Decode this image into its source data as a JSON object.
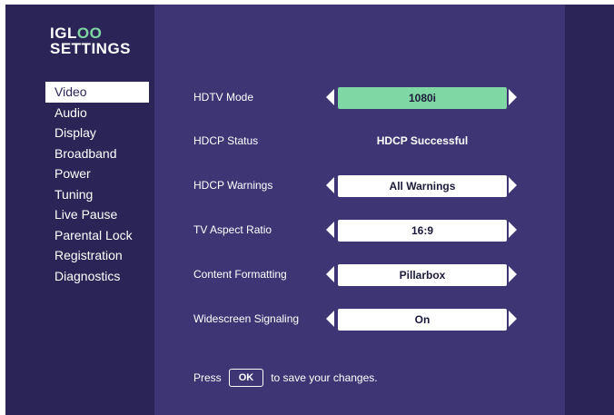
{
  "logo": {
    "line1_a": "IGL",
    "line1_b": "OO",
    "line2": "SETTINGS"
  },
  "nav": {
    "items": [
      {
        "label": "Video",
        "active": true
      },
      {
        "label": "Audio"
      },
      {
        "label": "Display"
      },
      {
        "label": "Broadband"
      },
      {
        "label": "Power"
      },
      {
        "label": "Tuning"
      },
      {
        "label": "Live Pause"
      },
      {
        "label": "Parental Lock"
      },
      {
        "label": "Registration"
      },
      {
        "label": "Diagnostics"
      }
    ]
  },
  "settings": [
    {
      "label": "HDTV Mode",
      "value": "1080i",
      "selectable": true,
      "selected": true
    },
    {
      "label": "HDCP Status",
      "value": "HDCP Successful",
      "selectable": false
    },
    {
      "label": "HDCP Warnings",
      "value": "All Warnings",
      "selectable": true
    },
    {
      "label": "TV Aspect Ratio",
      "value": "16:9",
      "selectable": true
    },
    {
      "label": "Content Formatting",
      "value": "Pillarbox",
      "selectable": true
    },
    {
      "label": "Widescreen Signaling",
      "value": "On",
      "selectable": true
    }
  ],
  "footer": {
    "press": "Press",
    "ok": "OK",
    "suffix": "to save your changes."
  },
  "colors": {
    "background": "#2a2556",
    "panel": "#3e3575",
    "accent": "#7fd7a3",
    "text": "#ffffff"
  }
}
